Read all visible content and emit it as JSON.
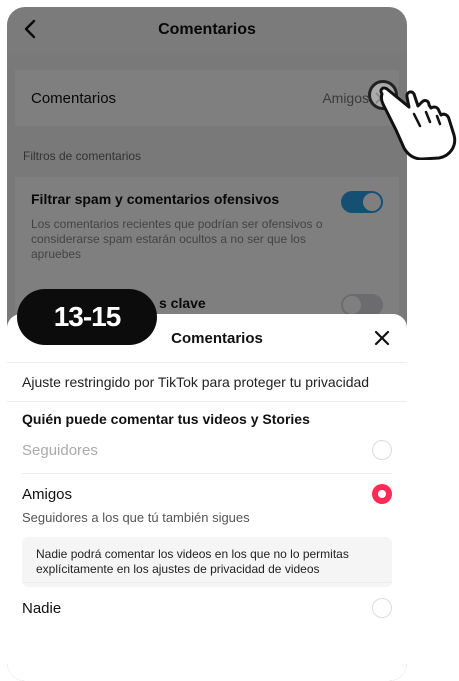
{
  "settings_page": {
    "title": "Comentarios",
    "comments_row": {
      "label": "Comentarios",
      "value": "Amigos"
    },
    "filters_header": "Filtros de comentarios",
    "spam_filter": {
      "title": "Filtrar spam y comentarios ofensivos",
      "description": "Los comentarios recientes que podrían ser ofensivos o considerarse spam estarán ocultos a no ser que los apruebes",
      "enabled": true
    },
    "keyword_filter": {
      "title_visible_part": "s clave",
      "enabled": false
    }
  },
  "sheet": {
    "title": "Comentarios",
    "restricted_notice": "Ajuste restringido por TikTok para proteger tu privacidad",
    "section_title": "Quién puede comentar tus videos y Stories",
    "options": {
      "followers": {
        "label": "Seguidores",
        "disabled": true
      },
      "friends": {
        "label": "Amigos",
        "subtitle": "Seguidores a los que tú también sigues",
        "selected": true,
        "note": "Nadie podrá comentar los videos en los que no lo permitas explícitamente en los ajustes de privacidad de videos"
      },
      "nobody": {
        "label": "Nadie"
      }
    }
  },
  "overlay": {
    "age_badge": "13-15"
  },
  "icons": {
    "back": "chevron-left-icon",
    "arrow": "chevron-right-icon",
    "close": "close-icon",
    "hand": "pointing-hand-icon"
  },
  "colors": {
    "accent": "#fe2c55",
    "toggle_on": "#2aa1e4",
    "badge_bg": "#0c0c0c"
  }
}
